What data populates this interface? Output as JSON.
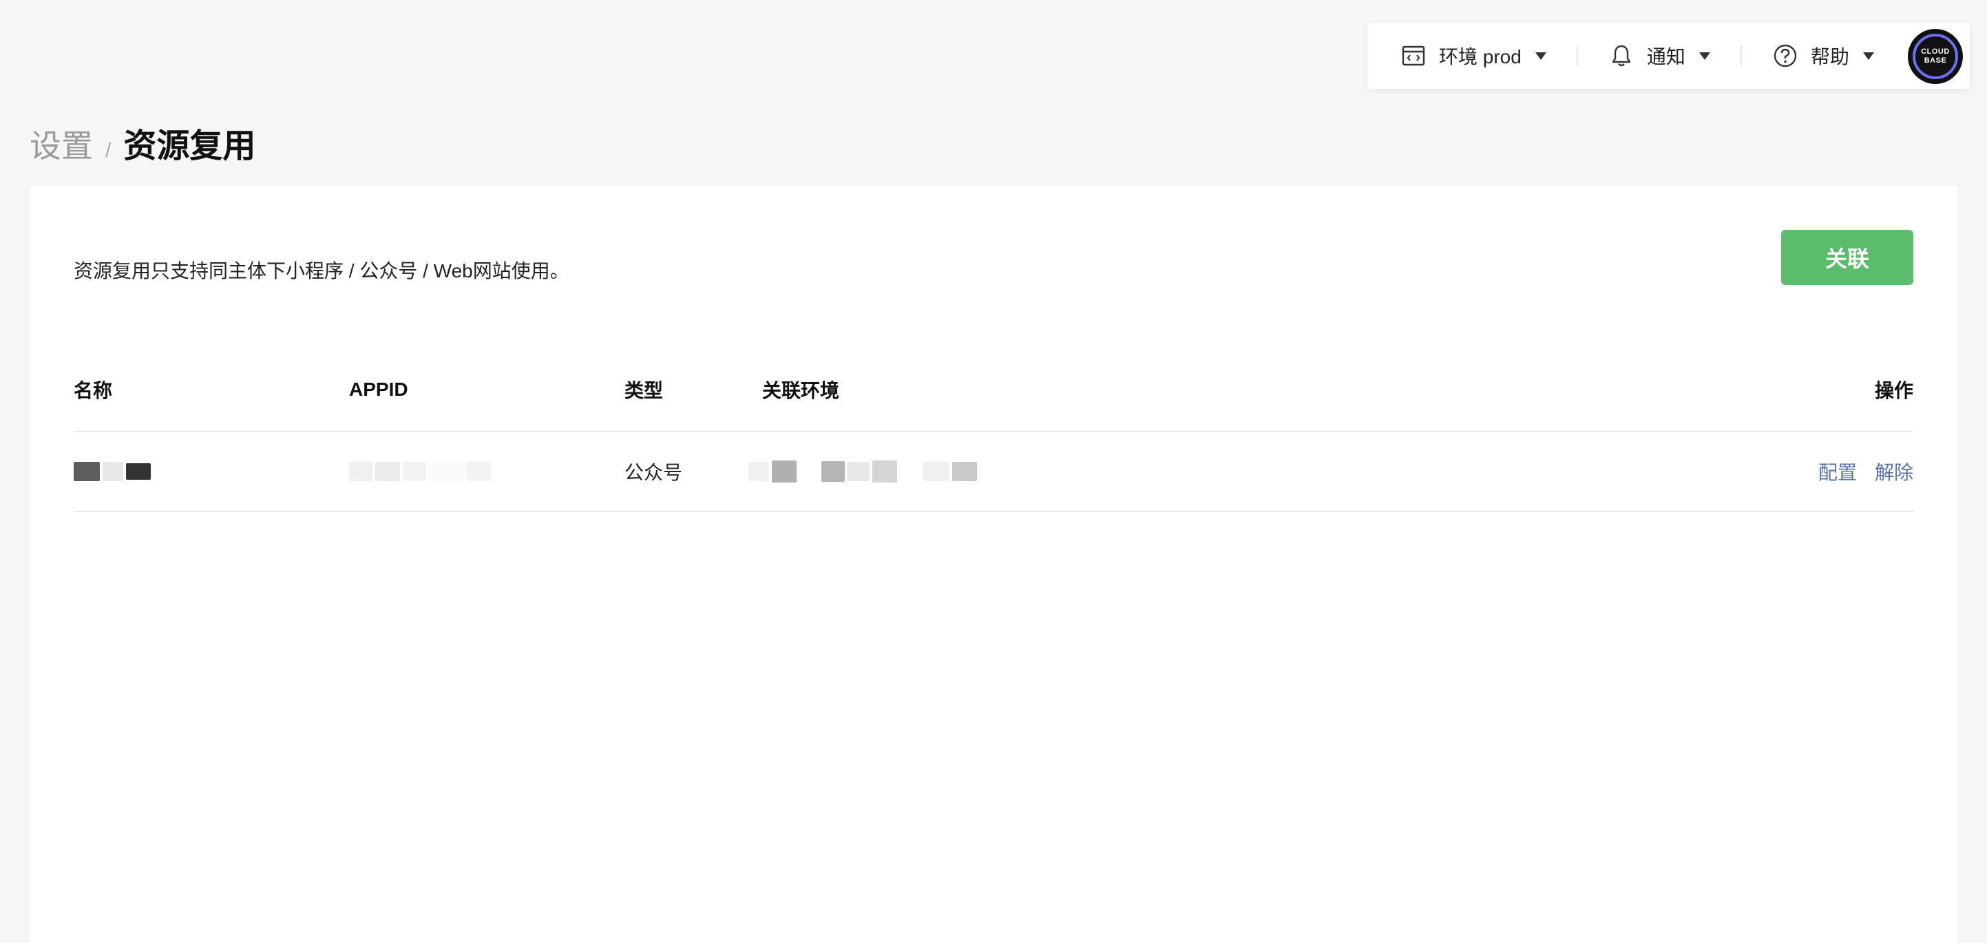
{
  "topbar": {
    "env_label": "环境 prod",
    "notice_label": "通知",
    "help_label": "帮助",
    "avatar_line1": "CLOUD",
    "avatar_line2": "BASE",
    "icons": {
      "env": "code-window-icon",
      "notice": "bell-icon",
      "help": "question-circle-icon"
    }
  },
  "breadcrumb": {
    "parent": "设置",
    "separator": "/",
    "current": "资源复用"
  },
  "card": {
    "description": "资源复用只支持同主体下小程序 / 公众号 / Web网站使用。",
    "associate_button": "关联"
  },
  "table": {
    "headers": {
      "name": "名称",
      "appid": "APPID",
      "type": "类型",
      "env": "关联环境",
      "ops": "操作"
    },
    "rows": [
      {
        "type": "公众号",
        "action_config": "配置",
        "action_unbind": "解除"
      }
    ]
  },
  "colors": {
    "primary_button": "#5bbd6b",
    "link": "#5b73a8",
    "page_background": "#f5f6f8"
  }
}
